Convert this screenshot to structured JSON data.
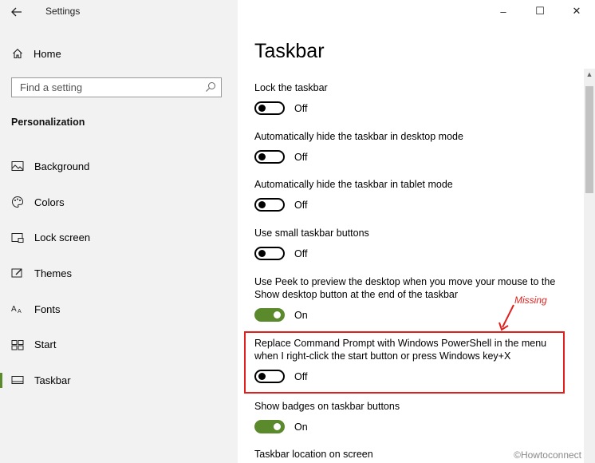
{
  "window": {
    "title": "Settings",
    "controls": {
      "minimize": "–",
      "maximize": "☐",
      "close": "✕"
    }
  },
  "sidebar": {
    "home_label": "Home",
    "search_placeholder": "Find a setting",
    "section_title": "Personalization",
    "items": [
      {
        "label": "Background",
        "icon": "image-icon"
      },
      {
        "label": "Colors",
        "icon": "palette-icon"
      },
      {
        "label": "Lock screen",
        "icon": "lock-screen-icon"
      },
      {
        "label": "Themes",
        "icon": "brush-icon"
      },
      {
        "label": "Fonts",
        "icon": "font-icon"
      },
      {
        "label": "Start",
        "icon": "start-icon"
      },
      {
        "label": "Taskbar",
        "icon": "taskbar-icon",
        "selected": true
      }
    ]
  },
  "main": {
    "title": "Taskbar",
    "settings": [
      {
        "label": "Lock the taskbar",
        "state": "Off",
        "on": false
      },
      {
        "label": "Automatically hide the taskbar in desktop mode",
        "state": "Off",
        "on": false
      },
      {
        "label": "Automatically hide the taskbar in tablet mode",
        "state": "Off",
        "on": false
      },
      {
        "label": "Use small taskbar buttons",
        "state": "Off",
        "on": false
      },
      {
        "label": "Use Peek to preview the desktop when you move your mouse to the Show desktop button at the end of the taskbar",
        "state": "On",
        "on": true
      },
      {
        "label": "Replace Command Prompt with Windows PowerShell in the menu when I right-click the start button or press Windows key+X",
        "state": "Off",
        "on": false
      },
      {
        "label": "Show badges on taskbar buttons",
        "state": "On",
        "on": true
      },
      {
        "label": "Taskbar location on screen"
      }
    ]
  },
  "annotation": {
    "text": "Missing",
    "color": "#e0201c"
  },
  "watermark": "©Howtoconnect",
  "colors": {
    "accent": "#5a8a2c",
    "sidebar_bg": "#f2f2f2",
    "highlight": "#e0201c"
  }
}
